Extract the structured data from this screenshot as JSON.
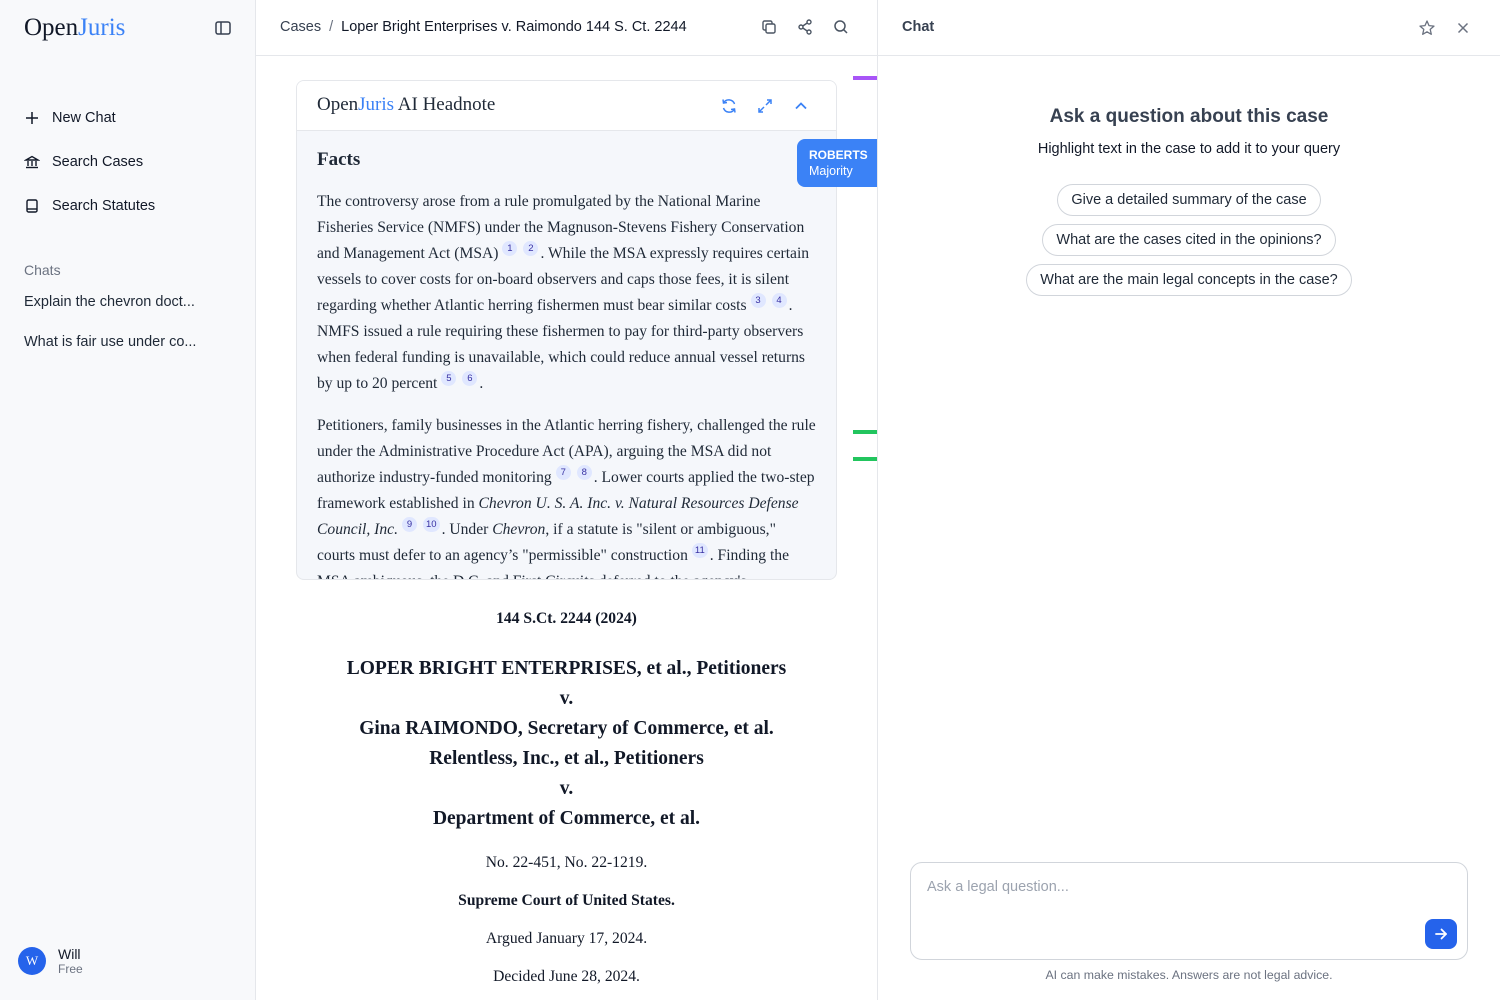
{
  "app": {
    "logo_open": "Open",
    "logo_juris": "Juris"
  },
  "sidebar": {
    "nav": [
      {
        "label": "New Chat",
        "icon": "plus-icon"
      },
      {
        "label": "Search Cases",
        "icon": "bank-icon"
      },
      {
        "label": "Search Statutes",
        "icon": "book-icon"
      }
    ],
    "chats_title": "Chats",
    "chats": [
      "Explain the chevron doct...",
      "What is fair use under co..."
    ],
    "user": {
      "initial": "W",
      "name": "Will",
      "plan": "Free"
    }
  },
  "breadcrumb": {
    "root": "Cases",
    "separator": "/",
    "current": "Loper Bright Enterprises v. Raimondo 144 S. Ct. 2244"
  },
  "headnote": {
    "brand_open": "Open",
    "brand_juris": "Juris",
    "brand_suffix": " AI Headnote",
    "heading": "Facts",
    "p1": {
      "a": "The controversy arose from a rule promulgated by the National Marine Fisheries Service (NMFS) under the Magnuson-Stevens Fishery Conservation and Management Act (MSA)",
      "c1": "1",
      "c2": "2",
      "b": ". While the MSA expressly requires certain vessels to cover costs for on-board observers and caps those fees, it is silent regarding whether Atlantic herring fishermen must bear similar costs",
      "c3": "3",
      "c4": "4",
      "c": ". NMFS issued a rule requiring these fishermen to pay for third-party observers when federal funding is unavailable, which could reduce annual vessel returns by up to 20 percent",
      "c5": "5",
      "c6": "6",
      "d": "."
    },
    "p2": {
      "a": "Petitioners, family businesses in the Atlantic herring fishery, challenged the rule under the Administrative Procedure Act (APA), arguing the MSA did not authorize industry-funded monitoring",
      "c7": "7",
      "c8": "8",
      "b": ". Lower courts applied the two-step framework established in ",
      "case_name": "Chevron U. S. A. Inc. v. Natural Resources Defense Council, Inc.",
      "c9": "9",
      "c10": "10",
      "c": ". Under ",
      "chevron": "Chevron",
      "d": ", if a statute is \"silent or ambiguous,\" courts must defer to an agency’s \"permissible\" construction",
      "c11": "11",
      "e": ". Finding the MSA ambiguous, the D.C. and First Circuits deferred to the agency's interpretation as"
    }
  },
  "opinion_tag": {
    "judge": "ROBERTS",
    "role": "Majority"
  },
  "markers": {
    "purple": "#a855f7",
    "green": "#22c55e"
  },
  "case": {
    "reporter": "144 S.Ct. 2244 (2024)",
    "parties": [
      "LOPER BRIGHT ENTERPRISES, et al., Petitioners",
      "v.",
      "Gina RAIMONDO, Secretary of Commerce, et al.",
      "Relentless, Inc., et al., Petitioners",
      "v.",
      "Department of Commerce, et al."
    ],
    "docket": "No. 22-451, No. 22-1219.",
    "court": "Supreme Court of United States.",
    "argued": "Argued January 17, 2024.",
    "decided": "Decided June 28, 2024."
  },
  "chat": {
    "title": "Chat",
    "ask_title": "Ask a question about this case",
    "ask_sub": "Highlight text in the case to add it to your query",
    "suggestions": [
      "Give a detailed summary of the case",
      "What are the cases cited in the opinions?",
      "What are the main legal concepts in the case?"
    ],
    "input_placeholder": "Ask a legal question...",
    "disclaimer": "AI can make mistakes. Answers are not legal advice."
  },
  "colors": {
    "accent": "#3b82f6",
    "button": "#2563eb"
  }
}
